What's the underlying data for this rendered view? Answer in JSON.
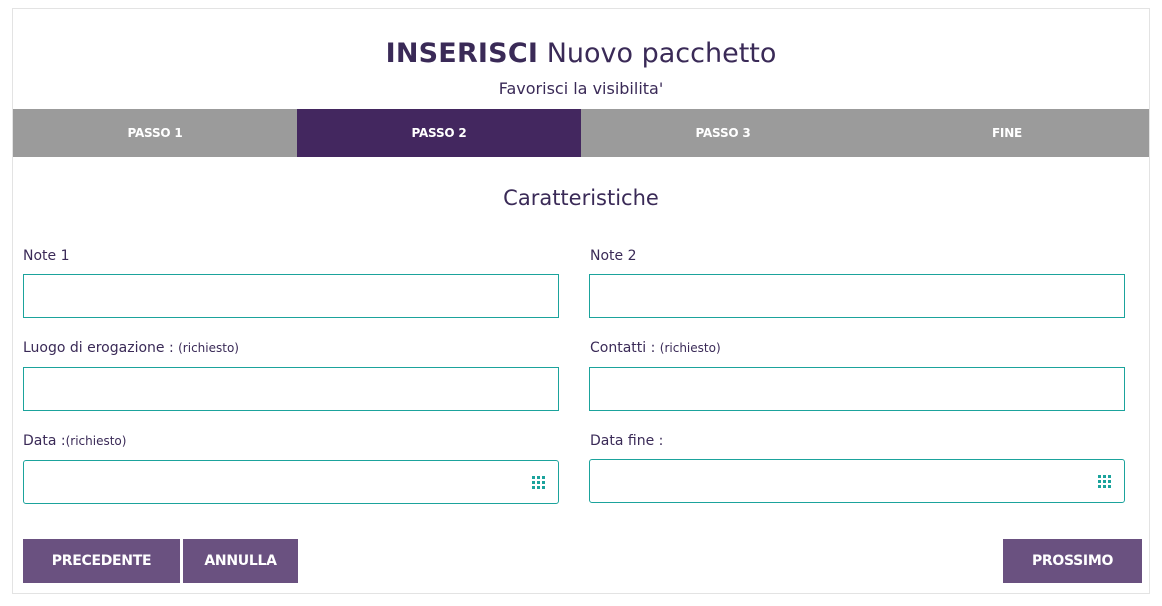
{
  "header": {
    "title_strong": "INSERISCI",
    "title_rest": "Nuovo pacchetto",
    "subtitle": "Favorisci la visibilita'"
  },
  "steps": [
    {
      "label": "PASSO 1",
      "active": false
    },
    {
      "label": "PASSO 2",
      "active": true
    },
    {
      "label": "PASSO 3",
      "active": false
    },
    {
      "label": "FINE",
      "active": false
    }
  ],
  "section_title": "Caratteristiche",
  "form": {
    "note1": {
      "label": "Note 1",
      "value": ""
    },
    "note2": {
      "label": "Note 2",
      "value": ""
    },
    "luogo": {
      "label": "Luogo di erogazione :",
      "hint": "(richiesto)",
      "value": ""
    },
    "contatti": {
      "label": "Contatti :",
      "hint": "(richiesto)",
      "value": ""
    },
    "data": {
      "label": "Data :",
      "hint": "(richiesto)",
      "value": ""
    },
    "data_fine": {
      "label": "Data fine :",
      "value": ""
    }
  },
  "buttons": {
    "previous": "PRECEDENTE",
    "cancel": "ANNULLA",
    "next": "PROSSIMO"
  },
  "icons": {
    "date_picker": "calendar-grid-icon"
  },
  "colors": {
    "primary": "#43275f",
    "button": "#6a5180",
    "step_inactive": "#9b9b9b",
    "field_border": "#1ba39c"
  }
}
